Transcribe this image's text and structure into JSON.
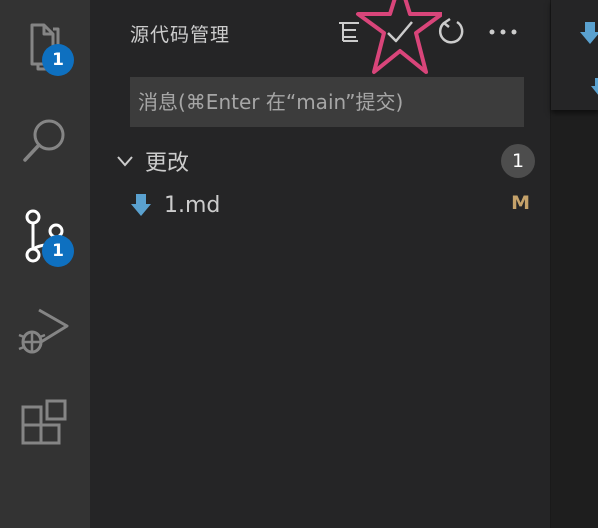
{
  "activity_bar": {
    "explorer_badge": "1",
    "scm_badge": "1"
  },
  "sidebar": {
    "title": "源代码管理",
    "commit_placeholder": "消息(⌘Enter 在“main”提交)",
    "changes_group": {
      "label": "更改",
      "count": "1"
    },
    "files": [
      {
        "name": "1.md",
        "status": "M"
      }
    ]
  },
  "colors": {
    "badge": "#0e70c0",
    "highlight_star": "#d9457a",
    "modified": "#c5a26a",
    "arrow": "#5aa1cf"
  }
}
